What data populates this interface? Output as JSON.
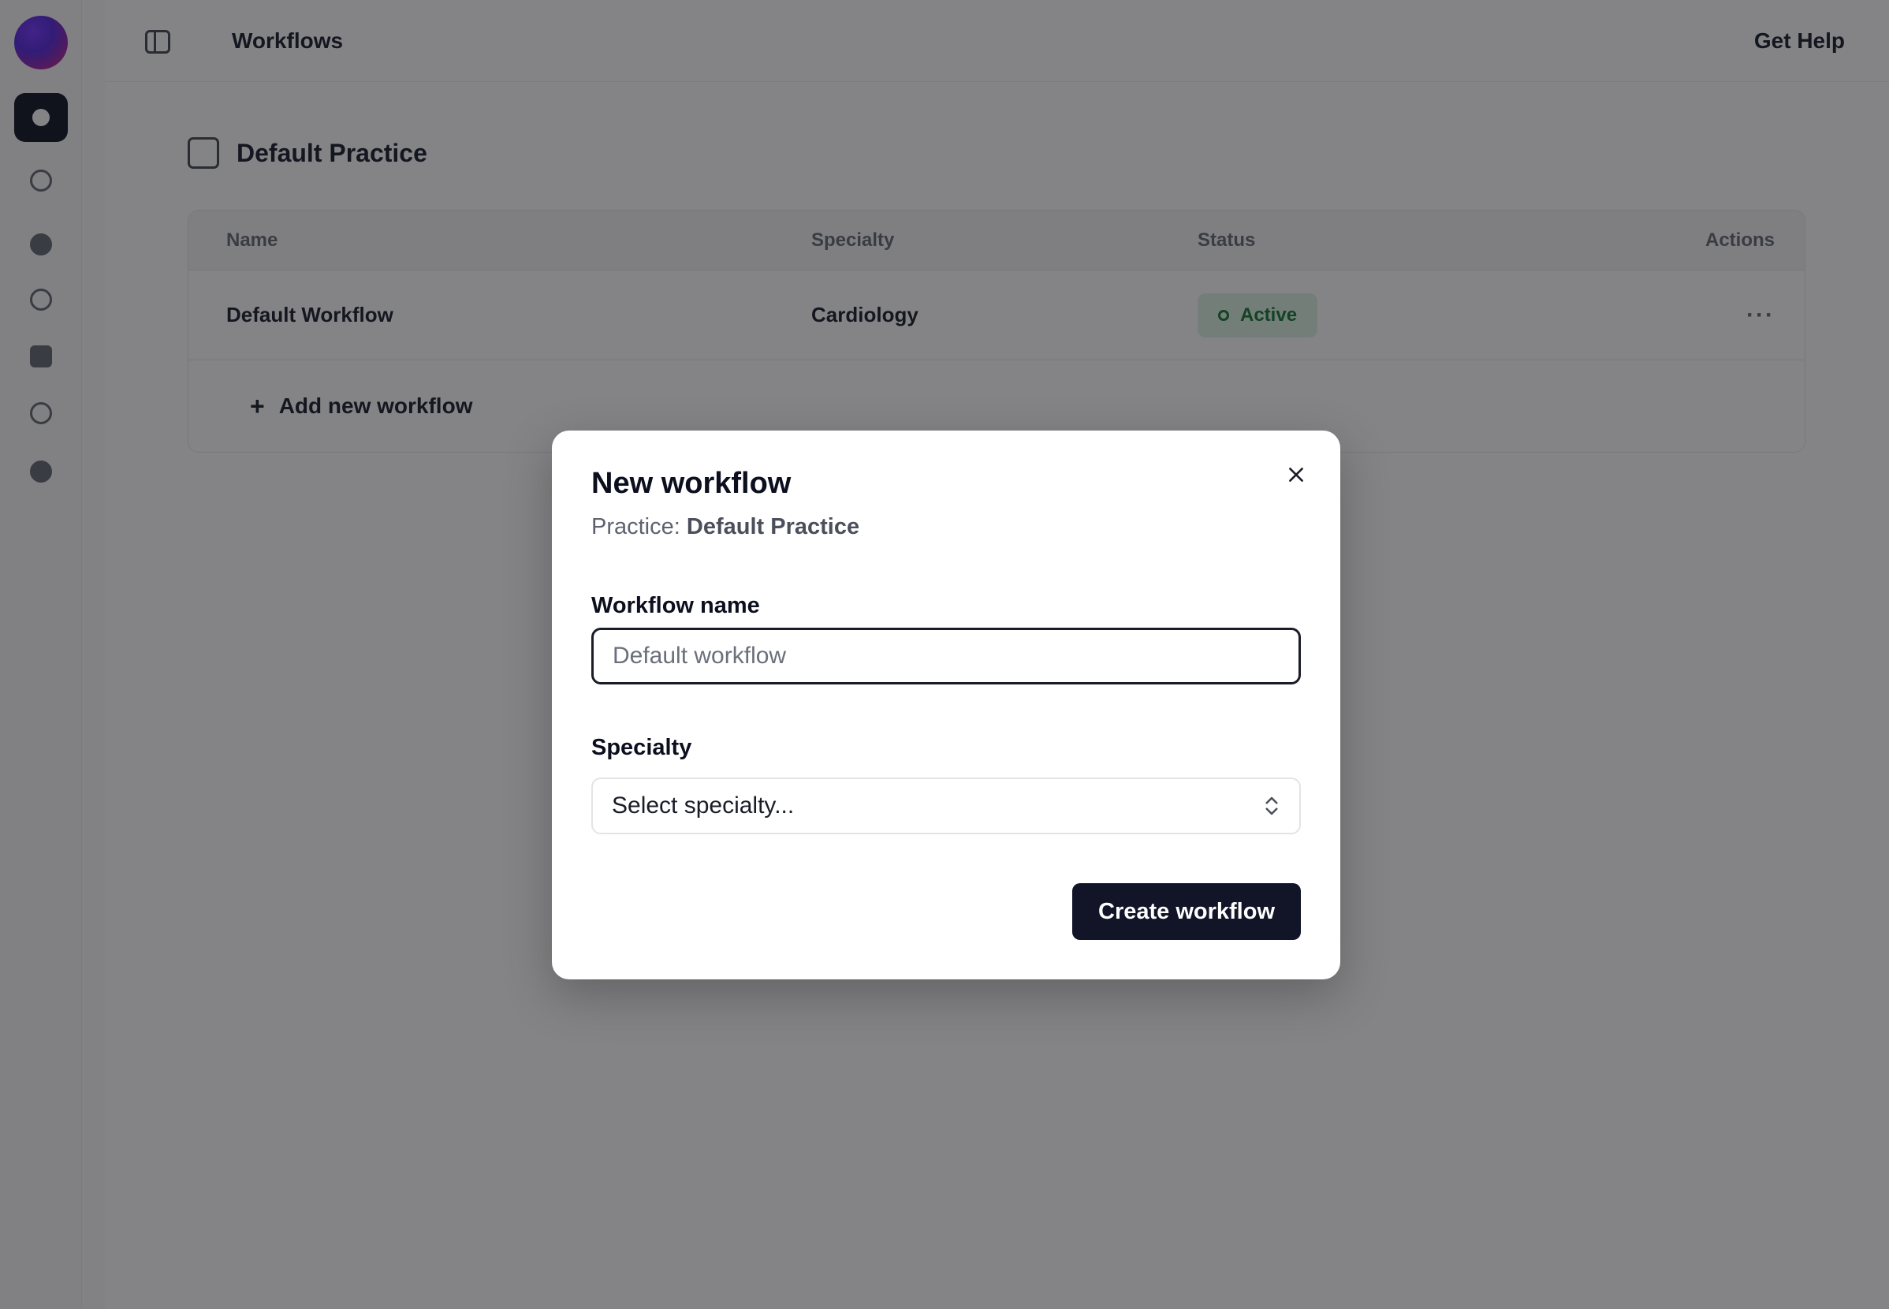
{
  "topbar": {
    "title": "Workflows",
    "help_label": "Get Help"
  },
  "practice": {
    "name": "Default Practice"
  },
  "table": {
    "columns": [
      "Name",
      "Specialty",
      "Status",
      "Actions"
    ],
    "rows": [
      {
        "name": "Default Workflow",
        "specialty": "Cardiology",
        "status": "Active",
        "actions": "···"
      }
    ],
    "add_label": "Add new workflow"
  },
  "modal": {
    "title": "New workflow",
    "subtitle_prefix": "Practice:",
    "subtitle_value": "Default Practice",
    "name_label": "Workflow name",
    "name_placeholder": "Default workflow",
    "name_value": "",
    "specialty_label": "Specialty",
    "specialty_placeholder": "Select specialty...",
    "submit_label": "Create workflow"
  },
  "colors": {
    "primary": "#111527",
    "overlay": "rgba(10,10,14,0.50)",
    "badge_bg": "#dff3e4",
    "badge_text": "#1d7a3a",
    "logo_gradient": [
      "#7b3cff",
      "#d42a7a"
    ]
  },
  "icons": {
    "close": "close-icon",
    "select": "chevrons-up-down-icon",
    "sidebar_toggle": "sidebar-toggle-icon",
    "add": "plus-icon"
  }
}
